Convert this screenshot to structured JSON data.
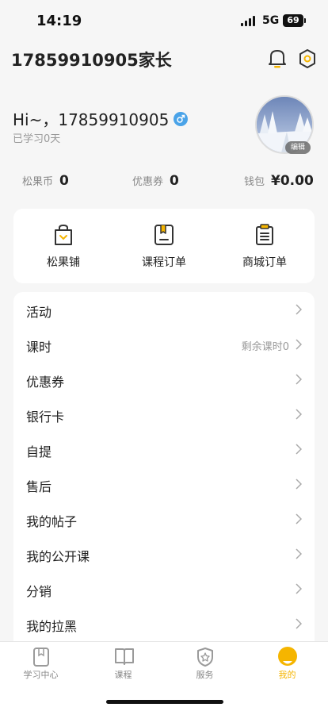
{
  "status_bar": {
    "time": "14:19",
    "network": "5G",
    "battery": "69"
  },
  "header": {
    "title": "17859910905家长"
  },
  "profile": {
    "greeting": "Hi~，17859910905",
    "study_days": "已学习0天",
    "edit_label": "编辑"
  },
  "stats": [
    {
      "label": "松果币",
      "value": "0"
    },
    {
      "label": "优惠券",
      "value": "0"
    },
    {
      "label": "钱包",
      "value": "¥0.00"
    }
  ],
  "quick_actions": [
    {
      "label": "松果铺",
      "icon": "shopping-bag-icon"
    },
    {
      "label": "课程订单",
      "icon": "course-order-icon"
    },
    {
      "label": "商城订单",
      "icon": "mall-order-icon"
    }
  ],
  "menu": [
    {
      "label": "活动",
      "extra": ""
    },
    {
      "label": "课时",
      "extra": "剩余课时0"
    },
    {
      "label": "优惠券",
      "extra": ""
    },
    {
      "label": "银行卡",
      "extra": ""
    },
    {
      "label": "自提",
      "extra": ""
    },
    {
      "label": "售后",
      "extra": ""
    },
    {
      "label": "我的帖子",
      "extra": ""
    },
    {
      "label": "我的公开课",
      "extra": ""
    },
    {
      "label": "分销",
      "extra": ""
    },
    {
      "label": "我的拉黑",
      "extra": ""
    }
  ],
  "tabs": [
    {
      "label": "学习中心",
      "icon": "study-center-icon",
      "active": false
    },
    {
      "label": "课程",
      "icon": "course-book-icon",
      "active": false
    },
    {
      "label": "服务",
      "icon": "service-shield-icon",
      "active": false
    },
    {
      "label": "我的",
      "icon": "profile-face-icon",
      "active": true
    }
  ],
  "colors": {
    "accent": "#f5b500",
    "background": "#f6f6f6",
    "gender": "#4aa3e8"
  }
}
